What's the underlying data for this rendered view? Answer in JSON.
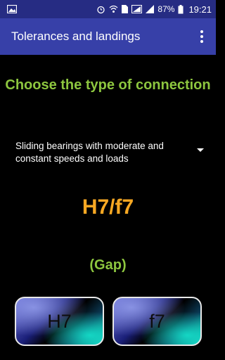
{
  "status_bar": {
    "battery_percent": "87%",
    "time": "19:21"
  },
  "app_bar": {
    "title": "Tolerances and landings"
  },
  "main": {
    "heading": "Choose the type of connection",
    "connection_type": "Sliding bearings with moderate and constant speeds and loads",
    "fit_code": "H7/f7",
    "fit_type": "(Gap)",
    "hole_tolerance_label": "H7",
    "shaft_tolerance_label": "f7"
  },
  "colors": {
    "status_bar": "#262c83",
    "app_bar": "#3740a8",
    "heading": "#8dc63f",
    "fit_code": "#f7a823"
  }
}
